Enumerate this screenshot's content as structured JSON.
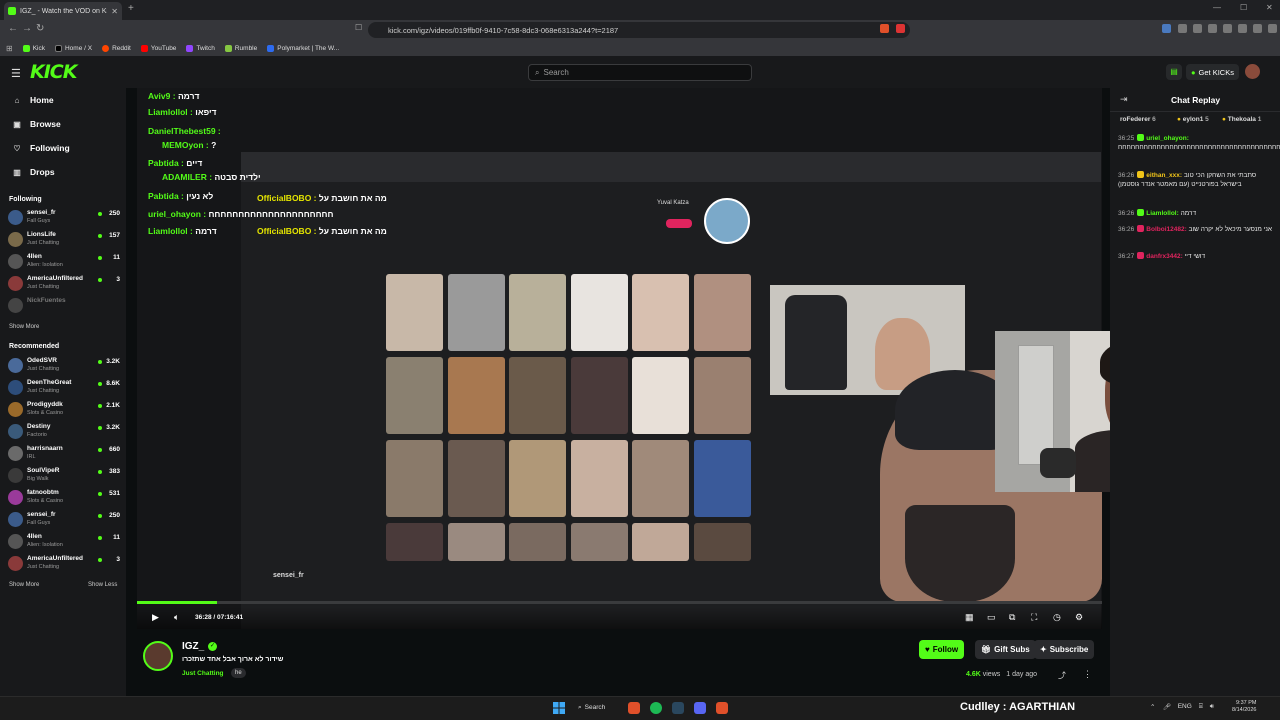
{
  "browser": {
    "tab_title": "IGZ_ - Watch the VOD on Kick",
    "tab_close": "✕",
    "new_tab": "+",
    "url": "kick.com/igz/videos/019ffb0f-9410-7c58-8dc3-068e6313a244?t=2187",
    "bookmarks": [
      "Kick",
      "Home / X",
      "Reddit",
      "YouTube",
      "Twitch",
      "Rumble",
      "Polymarket | The W..."
    ]
  },
  "kick_header": {
    "logo": "KICK",
    "search_placeholder": "Search",
    "get_kicks": "Get KICKs"
  },
  "sidebar": {
    "nav": [
      {
        "label": "Home",
        "icon": "home-icon"
      },
      {
        "label": "Browse",
        "icon": "browse-icon"
      },
      {
        "label": "Following",
        "icon": "heart-icon"
      },
      {
        "label": "Drops",
        "icon": "drops-icon"
      }
    ],
    "following_title": "Following",
    "following": [
      {
        "name": "sensei_fr",
        "category": "Fall Guys",
        "viewers": "250",
        "color": "#3b5b8a"
      },
      {
        "name": "LionsLife",
        "category": "Just Chatting",
        "viewers": "157",
        "color": "#7a6a4a"
      },
      {
        "name": "4llen",
        "category": "Alien: Isolation",
        "viewers": "11",
        "color": "#555"
      },
      {
        "name": "AmericaUnfiltered",
        "category": "Just Chatting",
        "viewers": "3",
        "color": "#8a3a3a"
      },
      {
        "name": "NickFuentes",
        "category": "",
        "viewers": "",
        "color": "#444",
        "offline": true
      }
    ],
    "show_more_1": "Show More",
    "recommended_title": "Recommended",
    "recommended": [
      {
        "name": "OdedSVR",
        "category": "Just Chatting",
        "viewers": "3.2K",
        "color": "#4a6a9a"
      },
      {
        "name": "DeenTheGreat",
        "category": "Just Chatting",
        "viewers": "8.6K",
        "color": "#2d4d7a"
      },
      {
        "name": "Prodigyddk",
        "category": "Slots & Casino",
        "viewers": "2.1K",
        "color": "#9a6a2a"
      },
      {
        "name": "Destiny",
        "category": "Factorio",
        "viewers": "3.2K",
        "color": "#3a5a7a"
      },
      {
        "name": "harrisnaarn",
        "category": "IRL",
        "viewers": "660",
        "color": "#6a6a6a"
      },
      {
        "name": "SoulVipeR",
        "category": "Big Walk",
        "viewers": "383",
        "color": "#3a3a3a"
      },
      {
        "name": "fatnoobtm",
        "category": "Slots & Casino",
        "viewers": "531",
        "color": "#9a3a9a"
      },
      {
        "name": "sensei_fr",
        "category": "Fall Guys",
        "viewers": "250",
        "color": "#3b5b8a"
      },
      {
        "name": "4llen",
        "category": "Alien: Isolation",
        "viewers": "11",
        "color": "#555"
      },
      {
        "name": "AmericaUnfiltered",
        "category": "Just Chatting",
        "viewers": "3",
        "color": "#8a3a3a"
      }
    ],
    "show_more_2": "Show More",
    "show_less": "Show Less"
  },
  "video_overlay_chat": [
    {
      "user": "Aviv9 :",
      "msg": "דרמה"
    },
    {
      "user": "Liamlollol :",
      "msg": "דיפאו"
    },
    {
      "user": "DanielThebest59 :",
      "msg": ""
    },
    {
      "user": "MEMOyon :",
      "msg": "?"
    },
    {
      "user": "Pabtida :",
      "msg": "דיים"
    },
    {
      "user": "ADAMILER :",
      "msg": "ילדית סבטה"
    },
    {
      "user": "Pabtida :",
      "msg": "לא נעין"
    },
    {
      "user": "uriel_ohayon :",
      "msg": "חחחחחחחחחחחחחחחחחחחחח"
    },
    {
      "user": "Liamlollol :",
      "msg": "דרמה"
    },
    {
      "user": "OfficialBOBO :",
      "msg": "מה את חושבת על"
    },
    {
      "user": "OfficialBOBO :",
      "msg": "מה את חושבת על"
    }
  ],
  "video_inner": {
    "profile_name": "Yuval Katza",
    "channel_chip": "sensei_fr"
  },
  "player": {
    "timecode": "36:28 / 07:16:41",
    "progress": 0.083
  },
  "channel": {
    "name": "IGZ_",
    "title": "שידור לא ארוך אבל אחד שתזכרו",
    "category": "Just Chatting",
    "language": "he",
    "follow": "Follow",
    "gift_subs": "Gift Subs",
    "subscribe": "Subscribe",
    "views": "4.6K",
    "views_suffix": " views",
    "age": "1 day ago"
  },
  "chat": {
    "title": "Chat Replay",
    "pinned": [
      {
        "user": "roFederer",
        "count": "6"
      },
      {
        "user": "eylon1",
        "count": "5"
      },
      {
        "user": "Thekoala",
        "count": "1"
      }
    ],
    "messages": [
      {
        "time": "36:25",
        "user": "uriel_ohayon:",
        "user_color": "#53fc18",
        "text": "חחחחחחחחחחחחחחחחחחחחחחחחחחחחחחחחחחחחחחחחחחחחחח"
      },
      {
        "time": "36:26",
        "user": "eithan_xxx:",
        "user_color": "#f0c419",
        "text": "סתבתי את השחקן הכי טוב בישראל בפורטנייט (עם מאמטר אנדר גוסטמן)"
      },
      {
        "time": "36:26",
        "user": "Liamlollol:",
        "user_color": "#53fc18",
        "text": "דרמה"
      },
      {
        "time": "36:26",
        "user": "Bolboi12482:",
        "user_color": "#e0245e",
        "text": "אני מנסער מיכאל לא יקרה שוב"
      },
      {
        "time": "36:27",
        "user": "danfrx3442:",
        "user_color": "#e0245e",
        "text": "דושי דיי"
      }
    ]
  },
  "taskbar": {
    "search": "Search",
    "now_playing": "Cudlley : AGARTHIAN",
    "lang": "ENG",
    "time": "9:37 PM",
    "date": "8/14/2026"
  }
}
